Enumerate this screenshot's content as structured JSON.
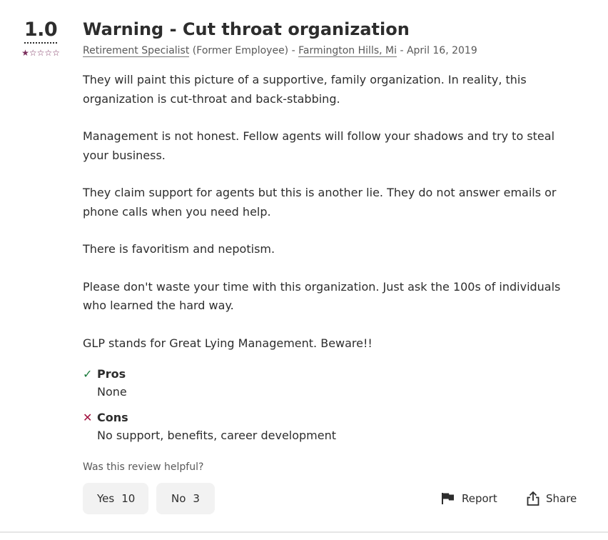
{
  "review": {
    "rating": "1.0",
    "stars": {
      "filled": 1,
      "total": 5,
      "filled_glyph": "★",
      "empty_glyph": "☆"
    },
    "title": "Warning - Cut throat organization",
    "meta": {
      "job_title": "Retirement Specialist",
      "employee_status": "(Former Employee)",
      "sep1": " - ",
      "location": "Farmington Hills, Mi",
      "sep2": " - ",
      "date": "April 16, 2019"
    },
    "paragraphs": [
      "They will paint this picture of a supportive, family organization. In reality, this organization is cut-throat and back-stabbing.",
      "Management is not honest. Fellow agents will follow your shadows and try to steal your business.",
      "They claim support for agents but this is another lie. They do not answer emails or phone calls when you need help.",
      "There is favoritism and nepotism.",
      "Please don't waste your time with this organization. Just ask the 100s of individuals who learned the hard way.",
      "GLP stands for Great Lying Management. Beware!!"
    ],
    "pros": {
      "label": "Pros",
      "text": "None",
      "icon": "check-icon"
    },
    "cons": {
      "label": "Cons",
      "text": "No support, benefits, career development",
      "icon": "x-icon"
    },
    "helpful": {
      "question": "Was this review helpful?",
      "yes_label": "Yes",
      "yes_count": "10",
      "no_label": "No",
      "no_count": "3"
    },
    "actions": {
      "report_label": "Report",
      "report_icon": "flag-icon",
      "share_label": "Share",
      "share_icon": "share-icon"
    }
  },
  "colors": {
    "star": "#7a2e5c",
    "check": "#1a7a3c",
    "x": "#a3123f",
    "button_bg": "#f2f2f2"
  }
}
